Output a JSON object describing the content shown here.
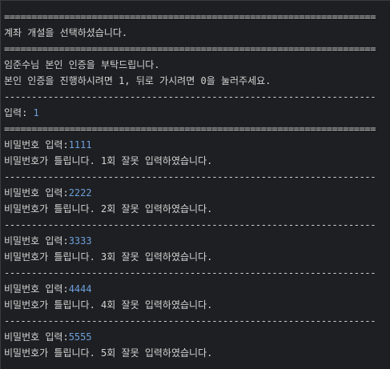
{
  "console": {
    "rule_double": "====================================================================",
    "rule_single": "--------------------------------------------------------------------",
    "header_title": "계좌 개설을 선택하셨습니다.",
    "auth_request": "임준수님 본인 인증을 부탁드립니다.",
    "auth_prompt": "본인 인증을 진행하시려면 1, 뒤로 가시려면 0을 눌러주세요.",
    "input_label": "입력: ",
    "input_value": "1",
    "password_label": "비밀번호 입력:",
    "attempts": [
      {
        "value": "1111",
        "message": "비밀번호가 틀립니다. 1회 잘못 입력하였습니다."
      },
      {
        "value": "2222",
        "message": "비밀번호가 틀립니다. 2회 잘못 입력하였습니다."
      },
      {
        "value": "3333",
        "message": "비밀번호가 틀립니다. 3회 잘못 입력하였습니다."
      },
      {
        "value": "4444",
        "message": "비밀번호가 틀립니다. 4회 잘못 입력하였습니다."
      },
      {
        "value": "5555",
        "message": "비밀번호가 틀립니다. 5회 잘못 입력하였습니다."
      }
    ]
  },
  "colors": {
    "background": "#1e1f22",
    "text": "#d4d4d4",
    "user_input": "#6ca0dc"
  }
}
